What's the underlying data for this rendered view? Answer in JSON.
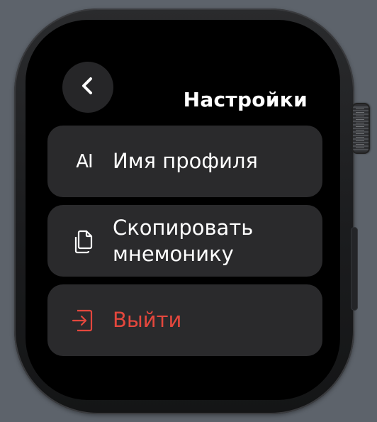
{
  "screen": {
    "title": "Настройки",
    "back_icon": "chevron-left-icon"
  },
  "menu": {
    "items": [
      {
        "label": "Имя профиля",
        "icon": "text-cursor-icon",
        "glyph": "AI",
        "color": "#ffffff"
      },
      {
        "label": "Скопировать мнемонику",
        "icon": "copy-documents-icon",
        "color": "#ffffff"
      },
      {
        "label": "Выйти",
        "icon": "logout-icon",
        "color": "#e4473d"
      }
    ]
  },
  "colors": {
    "accent_danger": "#e4473d",
    "row_background": "#2a2a2c",
    "screen_background": "#000000"
  }
}
